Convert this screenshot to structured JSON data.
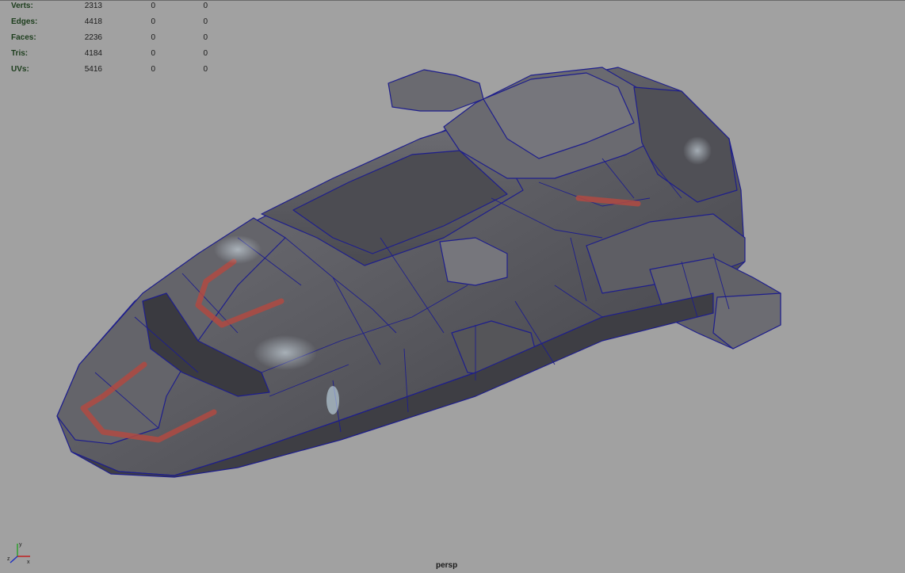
{
  "hud": {
    "rows": [
      {
        "label": "Verts:",
        "v1": "2313",
        "v2": "0",
        "v3": "0"
      },
      {
        "label": "Edges:",
        "v1": "4418",
        "v2": "0",
        "v3": "0"
      },
      {
        "label": "Faces:",
        "v1": "2236",
        "v2": "0",
        "v3": "0"
      },
      {
        "label": "Tris:",
        "v1": "4184",
        "v2": "0",
        "v3": "0"
      },
      {
        "label": "UVs:",
        "v1": "5416",
        "v2": "0",
        "v3": "0"
      }
    ]
  },
  "viewport": {
    "camera": "persp",
    "background": "#a1a1a1",
    "wire_color": "#1e1e8c",
    "hull_color": "#5a5a5e",
    "accent_color": "#b04a42"
  },
  "icons": {
    "axis": "view-axis-icon",
    "model": "spaceship-model"
  }
}
